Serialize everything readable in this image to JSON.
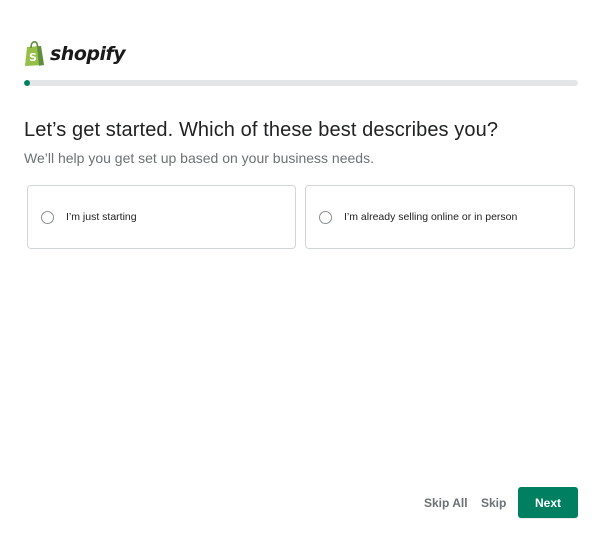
{
  "brand": {
    "name": "shopify",
    "logo_icon": "shopify-bag-icon",
    "color": "#95bf47"
  },
  "progress": {
    "fraction": 0.01,
    "color": "#008060"
  },
  "header": {
    "title": "Let’s get started. Which of these best describes you?",
    "subtitle": "We’ll help you get set up based on your business needs."
  },
  "options": [
    {
      "label": "I’m just starting",
      "selected": false
    },
    {
      "label": "I’m already selling online or in person",
      "selected": false
    }
  ],
  "footer": {
    "skip_all_label": "Skip All",
    "skip_label": "Skip",
    "next_label": "Next"
  },
  "colors": {
    "primary": "#008060",
    "text": "#202223",
    "subdued": "#6d7175"
  }
}
